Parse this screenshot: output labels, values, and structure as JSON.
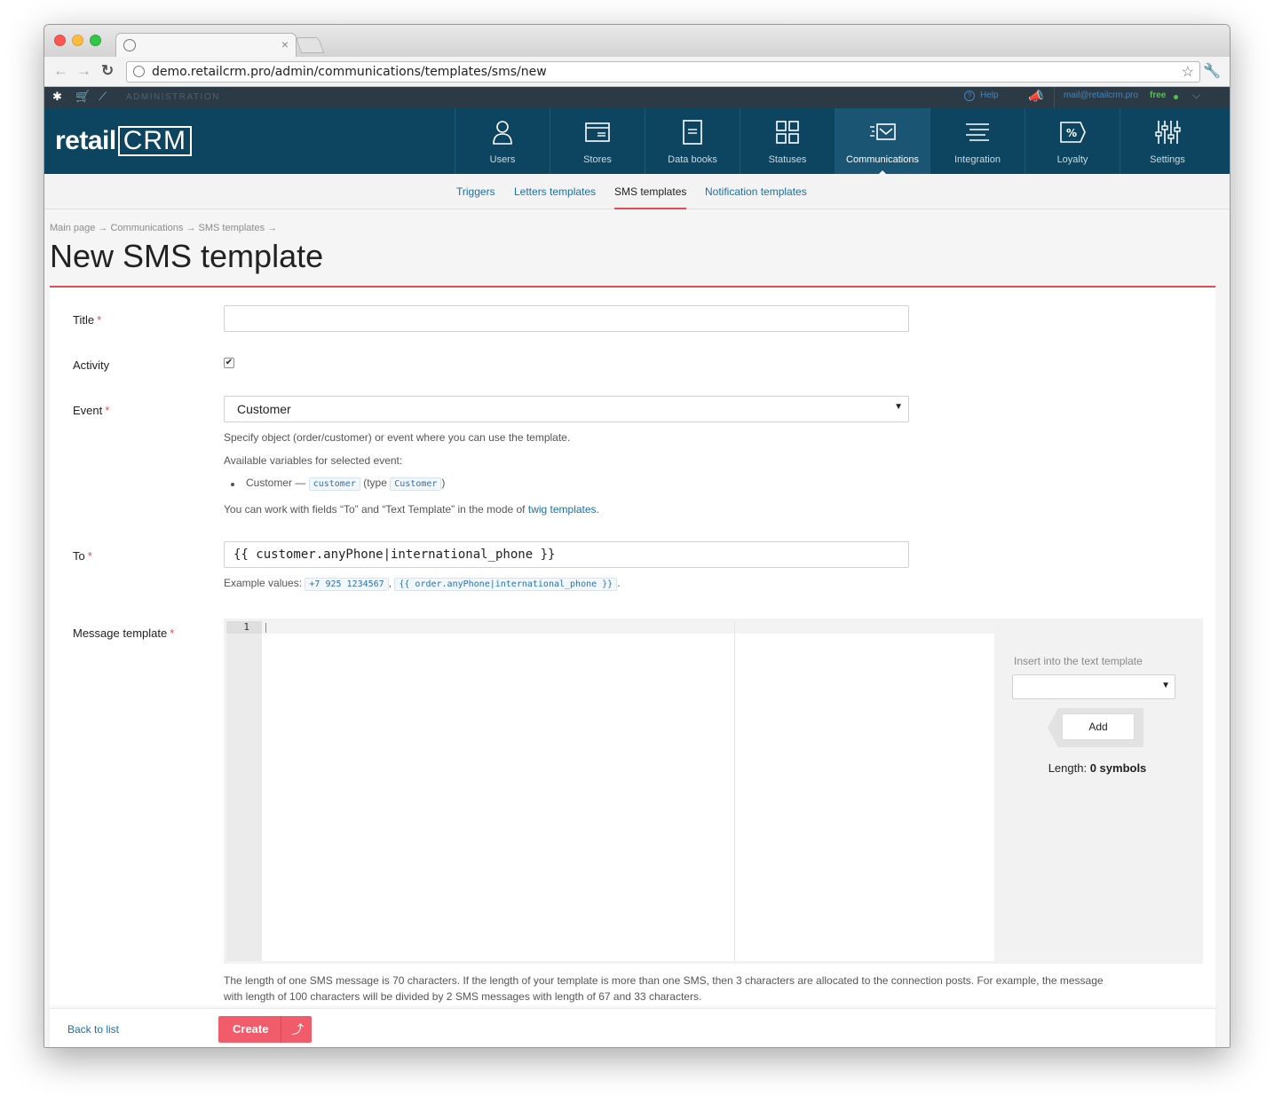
{
  "browser": {
    "url": "demo.retailcrm.pro/admin/communications/templates/sms/new"
  },
  "adminbar": {
    "label": "ADMINISTRATION",
    "help": "Help",
    "email": "mail@retailcrm.pro",
    "plan": "free"
  },
  "header": {
    "logo_prefix": "retail",
    "logo_suffix": "CRM",
    "nav": [
      {
        "label": "Users",
        "icon": "user-icon"
      },
      {
        "label": "Stores",
        "icon": "store-icon"
      },
      {
        "label": "Data books",
        "icon": "book-icon"
      },
      {
        "label": "Statuses",
        "icon": "grid-icon"
      },
      {
        "label": "Communications",
        "icon": "envelope-icon",
        "active": true
      },
      {
        "label": "Integration",
        "icon": "integration-icon"
      },
      {
        "label": "Loyalty",
        "icon": "percent-tag-icon"
      },
      {
        "label": "Settings",
        "icon": "sliders-icon"
      }
    ]
  },
  "subnav": {
    "items": [
      "Triggers",
      "Letters templates",
      "SMS templates",
      "Notification templates"
    ],
    "active": "SMS templates"
  },
  "page": {
    "breadcrumb": "Main page → Communications → SMS templates →",
    "title": "New SMS template"
  },
  "form": {
    "title_label": "Title",
    "title_value": "",
    "activity_label": "Activity",
    "activity_checked": true,
    "event_label": "Event",
    "event_value": "Customer",
    "event_hint": "Specify object (order/customer) or event where you can use the template.",
    "vars_heading": "Available variables for selected event:",
    "var_name": "Customer —",
    "var_code": "customer",
    "var_type_open": "(type",
    "var_type": "Customer",
    "var_type_close": ")",
    "twig_prefix": "You can work with fields “To” and “Text Template” in the mode of",
    "twig_link": "twig templates",
    "twig_suffix": ".",
    "to_label": "To",
    "to_value": "{{ customer.anyPhone|international_phone }}",
    "example_prefix": "Example values:",
    "example_1": "+7 925 1234567",
    "example_sep": ",",
    "example_2": "{{ order.anyPhone|international_phone }}",
    "example_end": ".",
    "message_label": "Message template",
    "line_number": "1",
    "insert_label": "Insert into the text template",
    "insert_value": "",
    "add_button": "Add",
    "length_label": "Length:",
    "length_value": "0 symbols",
    "sms_note": "The length of one SMS message is 70 characters. If the length of your template is more than one SMS, then 3 characters are allocated to the connection posts. For example, the message with length of 100 characters will be divided by 2 SMS messages with length of 67 and 33 characters."
  },
  "footer": {
    "back_link": "Back to list",
    "create_button": "Create"
  },
  "colors": {
    "header_bg": "#0d4560",
    "accent_red": "#e14d57",
    "link_blue": "#1c6fa5",
    "create_button": "#f05c6a"
  }
}
